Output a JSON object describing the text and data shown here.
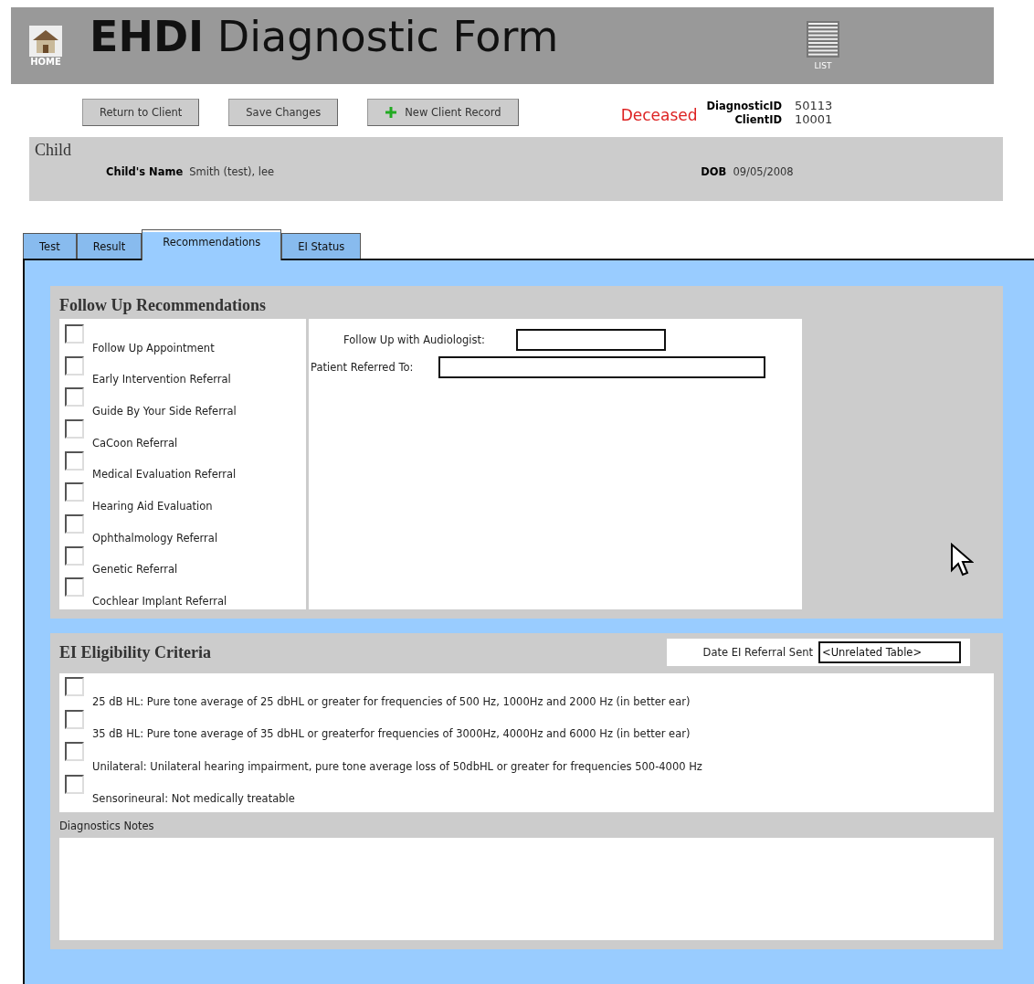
{
  "header": {
    "home_label": "HOME",
    "title_bold": "EHDI",
    "title_rest": "Diagnostic Form",
    "list_label": "LIST"
  },
  "toolbar": {
    "buttons": [
      {
        "label": "Return to Client",
        "kind": "plain"
      },
      {
        "label": "Save Changes",
        "kind": "plain"
      },
      {
        "label": "New Client Record",
        "kind": "add"
      }
    ],
    "status": "Deceased",
    "diagnostic_id_label": "DiagnosticID",
    "diagnostic_id": "50113",
    "client_id_label": "ClientID",
    "client_id": "10001"
  },
  "child": {
    "heading": "Child",
    "name_label": "Child's Name",
    "name": "Smith (test),  lee",
    "dob_label": "DOB",
    "dob": "09/05/2008"
  },
  "tabs": [
    {
      "label": "Test",
      "selected": false
    },
    {
      "label": "Result",
      "selected": false
    },
    {
      "label": "Recommendations",
      "selected": true
    },
    {
      "label": "EI Status",
      "selected": false
    }
  ],
  "follow_up": {
    "heading": "Follow Up Recommendations",
    "items": [
      {
        "label": "Follow Up Appointment",
        "checked": false
      },
      {
        "label": "Early Intervention Referral",
        "checked": false
      },
      {
        "label": "Guide By Your Side Referral",
        "checked": false
      },
      {
        "label": "CaCoon Referral",
        "checked": false
      },
      {
        "label": "Medical Evaluation Referral",
        "checked": false
      },
      {
        "label": "Hearing Aid Evaluation",
        "checked": false
      },
      {
        "label": "Ophthalmology Referral",
        "checked": false
      },
      {
        "label": "Genetic Referral",
        "checked": false
      },
      {
        "label": "Cochlear Implant Referral",
        "checked": false
      }
    ],
    "audiologist_label": "Follow Up with Audiologist:",
    "referred_label": "Patient Referred To:"
  },
  "ei": {
    "heading": "EI Eligibility Criteria",
    "date_label": "Date EI Referral Sent",
    "date_value": "<Unrelated Table>",
    "criteria": [
      {
        "label": "25 dB HL: Pure tone average of 25 dbHL or greater for frequencies of 500 Hz, 1000Hz and 2000 Hz (in better ear)",
        "checked": false
      },
      {
        "label": "35 dB HL: Pure tone average of 35 dbHL or greaterfor frequencies of 3000Hz, 4000Hz and 6000 Hz (in better ear)",
        "checked": false
      },
      {
        "label": "Unilateral: Unilateral hearing impairment, pure tone average loss of 50dbHL or greater for frequencies 500-4000 Hz",
        "checked": false
      },
      {
        "label": "Sensorineural: Not medically treatable",
        "checked": false
      }
    ],
    "notes_label": "Diagnostics Notes"
  }
}
